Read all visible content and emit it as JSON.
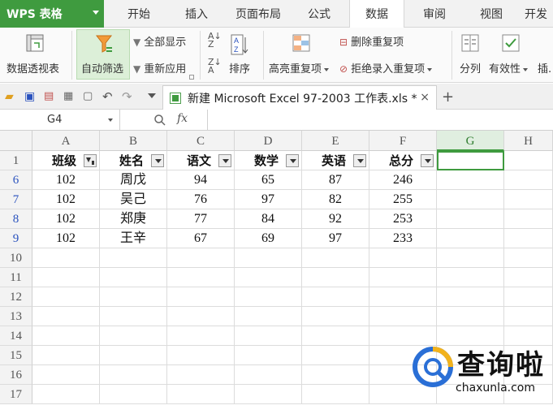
{
  "app": {
    "brand": "WPS 表格",
    "tabs": [
      "开始",
      "插入",
      "页面布局",
      "公式",
      "数据",
      "审阅",
      "视图",
      "开发"
    ],
    "active_tab": "数据"
  },
  "ribbon": {
    "pivot_label": "数据透视表",
    "autofilter_label": "自动筛选",
    "show_all_label": "全部显示",
    "reapply_label": "重新应用",
    "sort_label": "排序",
    "highlight_dup_label": "高亮重复项",
    "remove_dup_label": "删除重复项",
    "reject_dup_label": "拒绝录入重复项",
    "split_label": "分列",
    "validity_label": "有效性",
    "insert_label": "插"
  },
  "document": {
    "tab_title": "新建 Microsoft Excel 97-2003 工作表.xls *",
    "close_symbol": "×",
    "new_tab_symbol": "+"
  },
  "formula_bar": {
    "name_box": "G4",
    "fx_symbol": "fx",
    "value": ""
  },
  "sheet": {
    "columns": [
      "A",
      "B",
      "C",
      "D",
      "E",
      "F",
      "G",
      "H"
    ],
    "selected_column": "G",
    "selected_cell": "G4",
    "header_row": {
      "row": "1",
      "cells": [
        "班级",
        "姓名",
        "语文",
        "数学",
        "英语",
        "总分"
      ]
    },
    "rows": [
      {
        "row": "6",
        "cells": [
          "102",
          "周戊",
          "94",
          "65",
          "87",
          "246"
        ]
      },
      {
        "row": "7",
        "cells": [
          "102",
          "吴己",
          "76",
          "97",
          "82",
          "255"
        ]
      },
      {
        "row": "8",
        "cells": [
          "102",
          "郑庚",
          "77",
          "84",
          "92",
          "253"
        ]
      },
      {
        "row": "9",
        "cells": [
          "102",
          "王辛",
          "67",
          "69",
          "97",
          "233"
        ]
      }
    ],
    "empty_rows": [
      "10",
      "11",
      "12",
      "13",
      "14",
      "15",
      "16",
      "17"
    ]
  },
  "watermark": {
    "brand": "查询啦",
    "url": "chaxunla.com"
  },
  "colors": {
    "brand_green": "#3f9b3f",
    "filtered_row_number": "#2a52be"
  }
}
